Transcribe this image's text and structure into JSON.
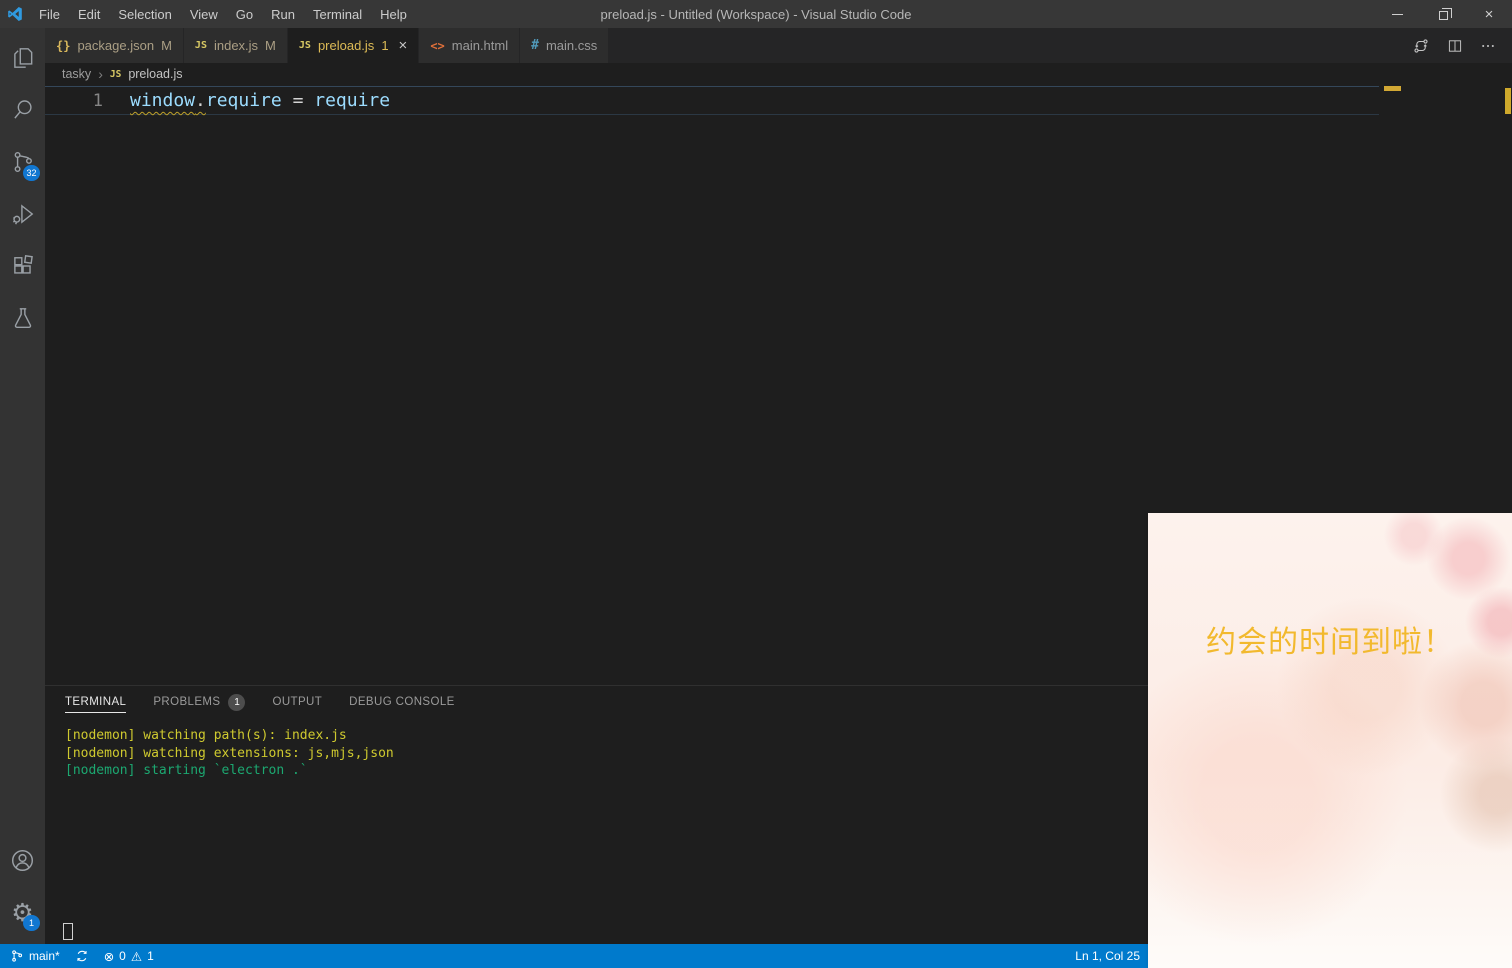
{
  "window": {
    "title": "preload.js - Untitled (Workspace) - Visual Studio Code"
  },
  "menu": {
    "items": [
      "File",
      "Edit",
      "Selection",
      "View",
      "Go",
      "Run",
      "Terminal",
      "Help"
    ]
  },
  "activity_bar": {
    "source_control_badge": "32",
    "settings_badge": "1"
  },
  "tabs": [
    {
      "icon": "{}",
      "label": "package.json",
      "suffix": "M"
    },
    {
      "icon": "JS",
      "label": "index.js",
      "suffix": "M"
    },
    {
      "icon": "JS",
      "label": "preload.js",
      "suffix": "1"
    },
    {
      "icon": "<>",
      "label": "main.html"
    },
    {
      "icon": "#",
      "label": "main.css"
    }
  ],
  "breadcrumb": {
    "folder": "tasky",
    "file_icon": "JS",
    "file": "preload.js"
  },
  "editor": {
    "line_number": "1",
    "code": {
      "object": "window",
      "dot": ".",
      "property": "require",
      "operator": " = ",
      "value": "require"
    }
  },
  "panel": {
    "tabs": [
      {
        "label": "TERMINAL"
      },
      {
        "label": "PROBLEMS",
        "badge": "1"
      },
      {
        "label": "OUTPUT"
      },
      {
        "label": "DEBUG CONSOLE"
      }
    ],
    "terminal_lines": [
      {
        "text": "[nodemon] watching path(s): index.js",
        "color": "#cfca2f"
      },
      {
        "text": "[nodemon] watching extensions: js,mjs,json",
        "color": "#cfca2f"
      },
      {
        "text": "[nodemon] starting `electron .`",
        "color": "#1ca871"
      }
    ]
  },
  "status_bar": {
    "branch": "main*",
    "errors": "0",
    "warnings": "1",
    "cursor_position": "Ln 1, Col 25"
  },
  "overlay_app": {
    "message": "约会的时间到啦！",
    "text_color": "#f2b92e"
  },
  "icons": {
    "close": "×",
    "chevron_separator": "›",
    "settings_gear": "⚙",
    "error": "⊗",
    "warning": "⚠"
  },
  "colors": {
    "status_bar": "#007acc",
    "badge_blue": "#1177d1",
    "terminal_yellow": "#cfca2f",
    "terminal_green": "#1ca871",
    "warning_squiggle": "#bfa22a",
    "code_identifier": "#9cdcfe",
    "overlay_text": "#f2b92e"
  }
}
